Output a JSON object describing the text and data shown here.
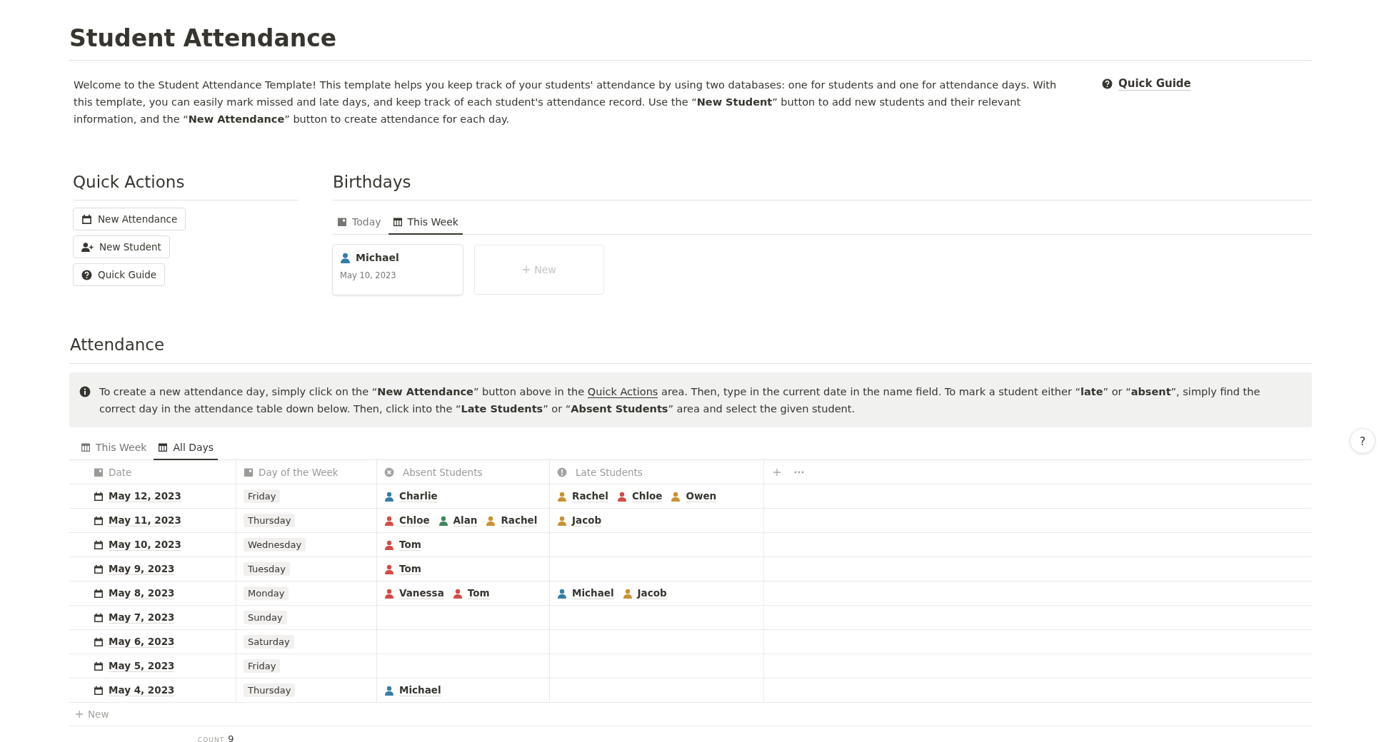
{
  "page": {
    "title": "Student Attendance"
  },
  "intro": {
    "text": "Welcome to the Student Attendance Template! This template helps you keep track of your students' attendance by using two databases: one for students and one for attendance days. With this template, you can easily mark missed and late days, and keep track of each student's attendance record. Use the “**New Student**” button to add new students and their relevant information, and the “**New Attendance**” button to create attendance for each day.",
    "link": "Quick Guide"
  },
  "quick_actions": {
    "heading": "Quick Actions",
    "buttons": [
      {
        "label": "New Attendance",
        "kind": "calendar"
      },
      {
        "label": "New Student",
        "kind": "person-add"
      },
      {
        "label": "Quick Guide",
        "kind": "help"
      }
    ]
  },
  "birthdays": {
    "heading": "Birthdays",
    "tabs": [
      {
        "label": "Today",
        "kind": "day",
        "selected": false
      },
      {
        "label": "This Week",
        "kind": "week",
        "selected": true
      }
    ],
    "cards": [
      {
        "name": "Michael",
        "date": "May 10, 2023",
        "color": "#337ea9"
      }
    ],
    "new_card": "New"
  },
  "attendance": {
    "heading": "Attendance",
    "callout": [
      {
        "kind": "text",
        "text": "To create a new attendance day, simply click on the “**New Attendance**” button above in the "
      },
      {
        "kind": "link",
        "text": "Quick Actions"
      },
      {
        "kind": "text",
        "text": " area. Then, type in the current date in the name field. To mark a student either “**late**” or “**absent**”, simply find the correct day in the attendance table down below. Then, click into the “**Late Students**” or “**Absent Students**” area and select the given student."
      }
    ],
    "tabs": [
      {
        "label": "This Week",
        "selected": false
      },
      {
        "label": "All Days",
        "selected": true
      }
    ],
    "columns": [
      {
        "label": "Date",
        "kind": "date"
      },
      {
        "label": "Day of the Week",
        "kind": "date"
      },
      {
        "label": "Absent Students",
        "kind": "absent"
      },
      {
        "label": "Late Students",
        "kind": "late"
      }
    ],
    "rows": [
      {
        "date": "May 12, 2023",
        "day": "Friday",
        "absent": [
          {
            "name": "Charlie",
            "color": "#337ea9"
          }
        ],
        "late": [
          {
            "name": "Rachel",
            "color": "#cb912f"
          },
          {
            "name": "Chloe",
            "color": "#d44c47"
          },
          {
            "name": "Owen",
            "color": "#cb912f"
          }
        ]
      },
      {
        "date": "May 11, 2023",
        "day": "Thursday",
        "absent": [
          {
            "name": "Chloe",
            "color": "#d44c47"
          },
          {
            "name": "Alan",
            "color": "#448361"
          },
          {
            "name": "Rachel",
            "color": "#cb912f"
          }
        ],
        "late": [
          {
            "name": "Jacob",
            "color": "#cb912f"
          }
        ]
      },
      {
        "date": "May 10, 2023",
        "day": "Wednesday",
        "absent": [
          {
            "name": "Tom",
            "color": "#d44c47"
          }
        ],
        "late": []
      },
      {
        "date": "May 9, 2023",
        "day": "Tuesday",
        "absent": [
          {
            "name": "Tom",
            "color": "#d44c47"
          }
        ],
        "late": []
      },
      {
        "date": "May 8, 2023",
        "day": "Monday",
        "absent": [
          {
            "name": "Vanessa",
            "color": "#d44c47"
          },
          {
            "name": "Tom",
            "color": "#d44c47"
          }
        ],
        "late": [
          {
            "name": "Michael",
            "color": "#337ea9"
          },
          {
            "name": "Jacob",
            "color": "#cb912f"
          }
        ]
      },
      {
        "date": "May 7, 2023",
        "day": "Sunday",
        "absent": [],
        "late": []
      },
      {
        "date": "May 6, 2023",
        "day": "Saturday",
        "absent": [],
        "late": []
      },
      {
        "date": "May 5, 2023",
        "day": "Friday",
        "absent": [],
        "late": []
      },
      {
        "date": "May 4, 2023",
        "day": "Thursday",
        "absent": [
          {
            "name": "Michael",
            "color": "#337ea9"
          }
        ],
        "late": []
      }
    ],
    "new_row": "New",
    "count_label": "COUNT",
    "count": "9"
  },
  "help_button": "?"
}
